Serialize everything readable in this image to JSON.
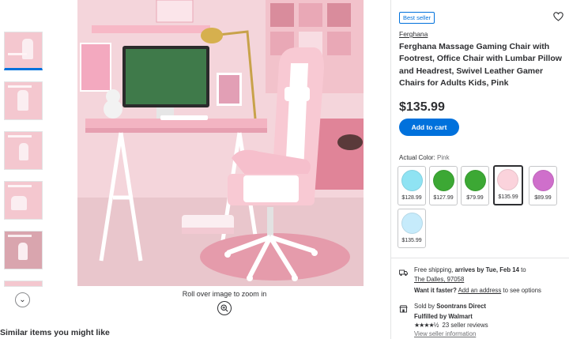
{
  "thumbnails": [
    {
      "label": "thumbnail-1",
      "active": true
    },
    {
      "label": "thumbnail-2"
    },
    {
      "label": "thumbnail-3"
    },
    {
      "label": "thumbnail-4"
    },
    {
      "label": "thumbnail-5"
    },
    {
      "label": "thumbnail-6"
    }
  ],
  "image": {
    "caption": "Roll over image to zoom in"
  },
  "similar_heading": "Similar items you might like",
  "product": {
    "badge": "Best seller",
    "brand": "Ferghana",
    "title": "Ferghana Massage Gaming Chair with Footrest, Office Chair with Lumbar Pillow and Headrest, Swivel Leather Gamer Chairs for Adults Kids, Pink",
    "price": "$135.99",
    "add_to_cart": "Add to cart",
    "actual_color_label": "Actual Color:",
    "actual_color_value": "Pink",
    "swatches": [
      {
        "color": "#8fe3f3",
        "price": "$128.99"
      },
      {
        "color": "#3ca834",
        "price": "$127.99"
      },
      {
        "color": "#3ca834",
        "price": "$79.99"
      },
      {
        "color": "#fbd3dc",
        "price": "$135.99",
        "selected": true
      },
      {
        "color": "#cf6fcb",
        "price": "$89.99"
      },
      {
        "color": "#c6ebfb",
        "price": "$135.99"
      }
    ]
  },
  "fulfillment": {
    "shipping_prefix": "Free shipping,",
    "shipping_bold": "arrives by Tue, Feb 14",
    "shipping_suffix": "to",
    "location": "The Dalles, 97058",
    "faster_bold": "Want it faster?",
    "faster_link": "Add an address",
    "faster_suffix": "to see options",
    "sold_by_prefix": "Sold by",
    "sold_by": "Soontrans Direct",
    "fulfilled_by": "Fulfilled by Walmart",
    "stars": "★★★★½",
    "reviews": "23 seller reviews",
    "seller_info": "View seller information"
  },
  "colors": {
    "accent": "#0071dc",
    "text": "#2e2f32",
    "border": "#e3e4e5"
  }
}
